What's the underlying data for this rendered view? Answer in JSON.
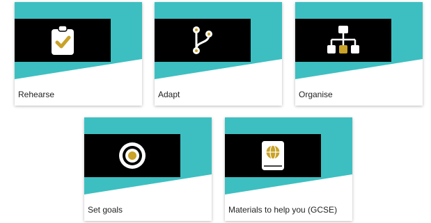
{
  "colors": {
    "teal": "#3dbfc1",
    "gold": "#c9a227",
    "icon_white": "#ffffff",
    "panel_black": "#000000"
  },
  "cards": [
    {
      "label": "Rehearse",
      "icon": "clipboard-check-icon"
    },
    {
      "label": "Adapt",
      "icon": "git-branch-icon"
    },
    {
      "label": "Organise",
      "icon": "sitemap-icon"
    },
    {
      "label": "Set goals",
      "icon": "target-icon"
    },
    {
      "label": "Materials to help you (GCSE)",
      "icon": "globe-book-icon"
    }
  ]
}
